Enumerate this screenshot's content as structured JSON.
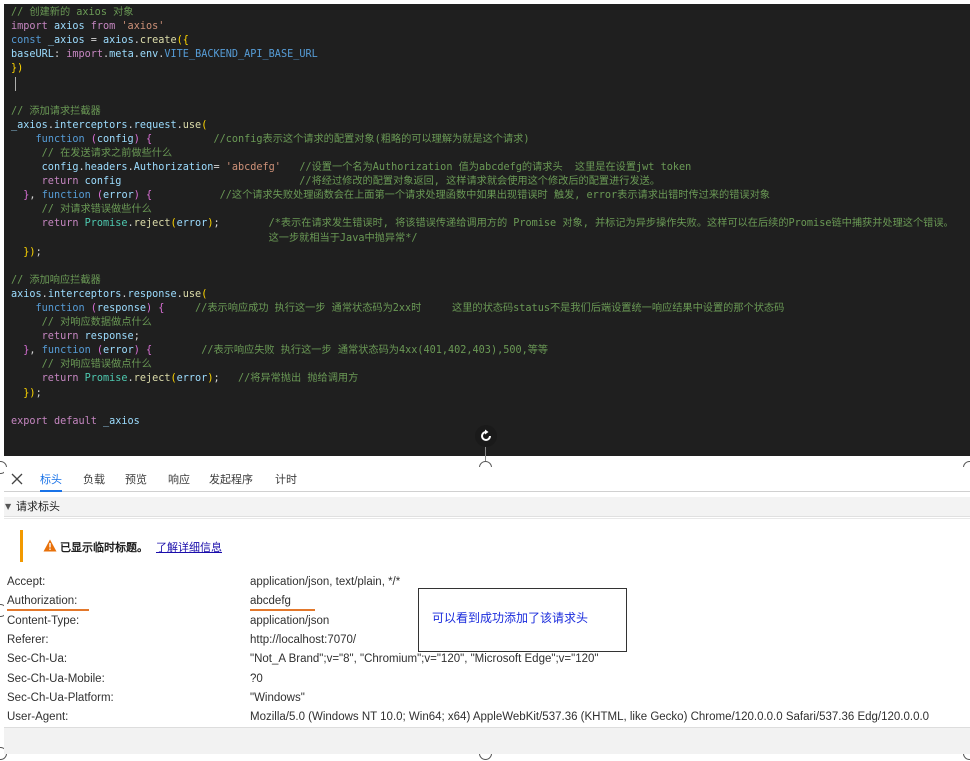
{
  "code_lines": [
    [
      {
        "c": "cm",
        "t": "// 创建新的 axios 对象"
      }
    ],
    [
      {
        "c": "kw",
        "t": "import "
      },
      {
        "c": "id",
        "t": "axios "
      },
      {
        "c": "kw",
        "t": "from "
      },
      {
        "c": "st",
        "t": "'axios'"
      }
    ],
    [
      {
        "c": "sk",
        "t": "const "
      },
      {
        "c": "id",
        "t": "_axios "
      },
      {
        "c": "df",
        "t": "= "
      },
      {
        "c": "id",
        "t": "axios"
      },
      {
        "c": "df",
        "t": "."
      },
      {
        "c": "fn",
        "t": "create"
      },
      {
        "c": "bk",
        "t": "({"
      }
    ],
    [
      {
        "c": "id",
        "t": "baseURL"
      },
      {
        "c": "df",
        "t": ": "
      },
      {
        "c": "kw",
        "t": "import"
      },
      {
        "c": "df",
        "t": "."
      },
      {
        "c": "id",
        "t": "meta"
      },
      {
        "c": "df",
        "t": "."
      },
      {
        "c": "id",
        "t": "env"
      },
      {
        "c": "df",
        "t": "."
      },
      {
        "c": "sk",
        "t": "VITE_BACKEND_API_BASE_URL"
      }
    ],
    [
      {
        "c": "bk",
        "t": "})"
      }
    ],
    [
      {
        "c": "df",
        "t": ""
      }
    ],
    [
      {
        "c": "df",
        "t": ""
      }
    ],
    [
      {
        "c": "cm",
        "t": "// 添加请求拦截器"
      }
    ],
    [
      {
        "c": "id",
        "t": "_axios"
      },
      {
        "c": "df",
        "t": "."
      },
      {
        "c": "id",
        "t": "interceptors"
      },
      {
        "c": "df",
        "t": "."
      },
      {
        "c": "id",
        "t": "request"
      },
      {
        "c": "df",
        "t": "."
      },
      {
        "c": "fn",
        "t": "use"
      },
      {
        "c": "bk",
        "t": "("
      }
    ],
    [
      {
        "c": "df",
        "t": "    "
      },
      {
        "c": "sk",
        "t": "function "
      },
      {
        "c": "pb",
        "t": "("
      },
      {
        "c": "id",
        "t": "config"
      },
      {
        "c": "pb",
        "t": ") "
      },
      {
        "c": "pb",
        "t": "{"
      },
      {
        "c": "df",
        "t": "          "
      },
      {
        "c": "cm",
        "t": "//config表示这个请求的配置对象(粗略的可以理解为就是这个请求)"
      }
    ],
    [
      {
        "c": "df",
        "t": "     "
      },
      {
        "c": "cm",
        "t": "// 在发送请求之前做些什么"
      }
    ],
    [
      {
        "c": "df",
        "t": "     "
      },
      {
        "c": "id",
        "t": "config"
      },
      {
        "c": "df",
        "t": "."
      },
      {
        "c": "id",
        "t": "headers"
      },
      {
        "c": "df",
        "t": "."
      },
      {
        "c": "id",
        "t": "Authorization"
      },
      {
        "c": "df",
        "t": "= "
      },
      {
        "c": "st",
        "t": "'abcdefg'"
      },
      {
        "c": "df",
        "t": "   "
      },
      {
        "c": "cm",
        "t": "//设置一个名为Authorization 值为abcdefg的请求头  这里是在设置jwt token"
      }
    ],
    [
      {
        "c": "df",
        "t": "     "
      },
      {
        "c": "kw",
        "t": "return "
      },
      {
        "c": "id",
        "t": "config"
      },
      {
        "c": "df",
        "t": "                             "
      },
      {
        "c": "cm",
        "t": "//将经过修改的配置对象返回, 这样请求就会使用这个修改后的配置进行发送。"
      }
    ],
    [
      {
        "c": "df",
        "t": "  "
      },
      {
        "c": "pb",
        "t": "}"
      },
      {
        "c": "df",
        "t": ", "
      },
      {
        "c": "sk",
        "t": "function "
      },
      {
        "c": "pb",
        "t": "("
      },
      {
        "c": "id",
        "t": "error"
      },
      {
        "c": "pb",
        "t": ") "
      },
      {
        "c": "pb",
        "t": "{"
      },
      {
        "c": "df",
        "t": "           "
      },
      {
        "c": "cm",
        "t": "//这个请求失败处理函数会在上面第一个请求处理函数中如果出现错误时 触发, error表示请求出错时传过来的错误对象"
      }
    ],
    [
      {
        "c": "df",
        "t": "     "
      },
      {
        "c": "cm",
        "t": "// 对请求错误做些什么"
      }
    ],
    [
      {
        "c": "df",
        "t": "     "
      },
      {
        "c": "kw",
        "t": "return "
      },
      {
        "c": "cl",
        "t": "Promise"
      },
      {
        "c": "df",
        "t": "."
      },
      {
        "c": "fn",
        "t": "reject"
      },
      {
        "c": "bk",
        "t": "("
      },
      {
        "c": "id",
        "t": "error"
      },
      {
        "c": "bk",
        "t": ")"
      },
      {
        "c": "df",
        "t": ";        "
      },
      {
        "c": "cm",
        "t": "/*表示在请求发生错误时, 将该错误传递给调用方的 Promise 对象, 并标记为异步操作失败。这样可以在后续的Promise链中捕获并处理这个错误。"
      }
    ],
    [
      {
        "c": "df",
        "t": "                                          "
      },
      {
        "c": "cm",
        "t": "这一步就相当于Java中抛异常*/"
      }
    ],
    [
      {
        "c": "df",
        "t": "  "
      },
      {
        "c": "bk",
        "t": "})"
      },
      {
        "c": "df",
        "t": ";"
      }
    ],
    [
      {
        "c": "df",
        "t": ""
      }
    ],
    [
      {
        "c": "cm",
        "t": "// 添加响应拦截器"
      }
    ],
    [
      {
        "c": "id",
        "t": "axios"
      },
      {
        "c": "df",
        "t": "."
      },
      {
        "c": "id",
        "t": "interceptors"
      },
      {
        "c": "df",
        "t": "."
      },
      {
        "c": "id",
        "t": "response"
      },
      {
        "c": "df",
        "t": "."
      },
      {
        "c": "fn",
        "t": "use"
      },
      {
        "c": "bk",
        "t": "("
      }
    ],
    [
      {
        "c": "df",
        "t": "    "
      },
      {
        "c": "sk",
        "t": "function "
      },
      {
        "c": "pb",
        "t": "("
      },
      {
        "c": "id",
        "t": "response"
      },
      {
        "c": "pb",
        "t": ") "
      },
      {
        "c": "pb",
        "t": "{"
      },
      {
        "c": "df",
        "t": "     "
      },
      {
        "c": "cm",
        "t": "//表示响应成功 执行这一步 通常状态码为2xx时     这里的状态码status不是我们后端设置统一响应结果中设置的那个状态码"
      }
    ],
    [
      {
        "c": "df",
        "t": "     "
      },
      {
        "c": "cm",
        "t": "// 对响应数据做点什么"
      }
    ],
    [
      {
        "c": "df",
        "t": "     "
      },
      {
        "c": "kw",
        "t": "return "
      },
      {
        "c": "id",
        "t": "response"
      },
      {
        "c": "df",
        "t": ";"
      }
    ],
    [
      {
        "c": "df",
        "t": "  "
      },
      {
        "c": "pb",
        "t": "}"
      },
      {
        "c": "df",
        "t": ", "
      },
      {
        "c": "sk",
        "t": "function "
      },
      {
        "c": "pb",
        "t": "("
      },
      {
        "c": "id",
        "t": "error"
      },
      {
        "c": "pb",
        "t": ") "
      },
      {
        "c": "pb",
        "t": "{"
      },
      {
        "c": "df",
        "t": "        "
      },
      {
        "c": "cm",
        "t": "//表示响应失败 执行这一步 通常状态码为4xx(401,402,403),500,等等"
      }
    ],
    [
      {
        "c": "df",
        "t": "     "
      },
      {
        "c": "cm",
        "t": "// 对响应错误做点什么"
      }
    ],
    [
      {
        "c": "df",
        "t": "     "
      },
      {
        "c": "kw",
        "t": "return "
      },
      {
        "c": "cl",
        "t": "Promise"
      },
      {
        "c": "df",
        "t": "."
      },
      {
        "c": "fn",
        "t": "reject"
      },
      {
        "c": "bk",
        "t": "("
      },
      {
        "c": "id",
        "t": "error"
      },
      {
        "c": "bk",
        "t": ")"
      },
      {
        "c": "df",
        "t": ";   "
      },
      {
        "c": "cm",
        "t": "//将异常抛出 抛给调用方"
      }
    ],
    [
      {
        "c": "df",
        "t": "  "
      },
      {
        "c": "bk",
        "t": "})"
      },
      {
        "c": "df",
        "t": ";"
      }
    ],
    [
      {
        "c": "df",
        "t": ""
      }
    ],
    [
      {
        "c": "kw",
        "t": "export "
      },
      {
        "c": "kw",
        "t": "default "
      },
      {
        "c": "id",
        "t": "_axios"
      }
    ]
  ],
  "devtools": {
    "tabs": [
      "标头",
      "负载",
      "预览",
      "响应",
      "发起程序",
      "计时"
    ],
    "active_tab": "标头",
    "section_title": "请求标头",
    "warning_text": "已显示临时标题。",
    "warning_link": "了解详细信息",
    "headers": [
      {
        "name": "Accept:",
        "value": "application/json, text/plain, */*"
      },
      {
        "name": "Authorization:",
        "value": "abcdefg"
      },
      {
        "name": "Content-Type:",
        "value": "application/json"
      },
      {
        "name": "Referer:",
        "value": "http://localhost:7070/"
      },
      {
        "name": "Sec-Ch-Ua:",
        "value": "\"Not_A Brand\";v=\"8\", \"Chromium\";v=\"120\", \"Microsoft Edge\";v=\"120\""
      },
      {
        "name": "Sec-Ch-Ua-Mobile:",
        "value": "?0"
      },
      {
        "name": "Sec-Ch-Ua-Platform:",
        "value": "\"Windows\""
      },
      {
        "name": "User-Agent:",
        "value": "Mozilla/5.0 (Windows NT 10.0; Win64; x64) AppleWebKit/537.36 (KHTML, like Gecko) Chrome/120.0.0.0 Safari/537.36 Edg/120.0.0.0"
      }
    ]
  },
  "annotation": {
    "text": "可以看到成功添加了该请求头",
    "color": "#1a2bdc"
  },
  "colors": {
    "editor_bg": "#1f1f1f",
    "active_tab": "#1a73e8",
    "warning": "#f29900",
    "underline": "#e3782b"
  }
}
